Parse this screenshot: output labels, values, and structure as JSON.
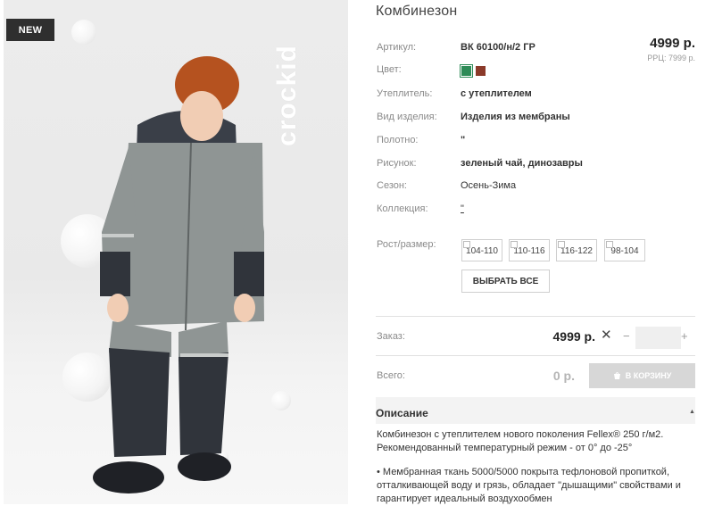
{
  "photo": {
    "badge": "NEW",
    "brand": "crockid"
  },
  "product": {
    "title": "Комбинезон",
    "price": "4999 р.",
    "rrp": "РРЦ: 7999 р.",
    "specs": [
      {
        "label": "Артикул:",
        "value": "ВК 60100/н/2 ГР"
      },
      {
        "label": "Цвет:",
        "value": ""
      },
      {
        "label": "Утеплитель:",
        "value": "с утеплителем"
      },
      {
        "label": "Вид изделия:",
        "value": "Изделия из мембраны"
      },
      {
        "label": "Полотно:",
        "value": "\""
      },
      {
        "label": "Рисунок:",
        "value": "зеленый чай, динозавры"
      },
      {
        "label": "Сезон:",
        "value": "Осень-Зима"
      },
      {
        "label": "Коллекция:",
        "value": "\""
      }
    ],
    "colors": [
      "#2e8b57",
      "#8b3a2a"
    ],
    "size_label": "Рост/размер:",
    "sizes": [
      "104-110",
      "110-116",
      "116-122",
      "98-104"
    ],
    "select_all": "ВЫБРАТЬ ВСЕ"
  },
  "order": {
    "label": "Заказ:",
    "price": "4999 р.",
    "remove": "✕",
    "minus": "−",
    "plus": "+",
    "quantity": ""
  },
  "total": {
    "label": "Всего:",
    "value": "0 р.",
    "cart_button": "В КОРЗИНУ"
  },
  "description": {
    "title": "Описание",
    "paragraph1": "Комбинезон с утеплителем нового поколения Fellex® 250 г/м2.",
    "paragraph2": "Рекомендованный температурный режим - от 0° до -25°",
    "paragraph3": "• Мембранная ткань 5000/5000 покрыта тефлоновой пропиткой,",
    "paragraph4": "отталкивающей воду и грязь, обладает \"дышащими\" свойствами и",
    "paragraph5": "гарантирует идеальный воздухообмен"
  }
}
